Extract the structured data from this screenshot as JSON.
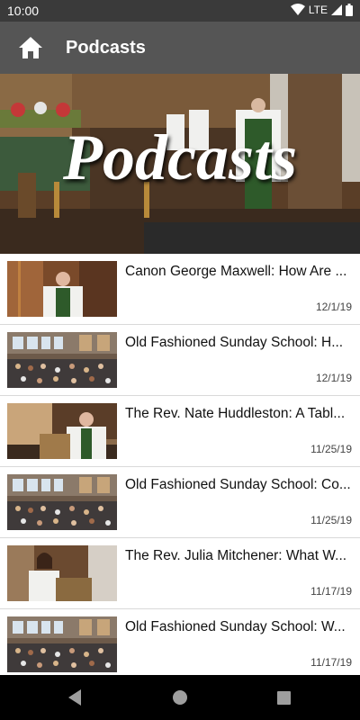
{
  "status_bar": {
    "time": "10:00",
    "network": "LTE"
  },
  "app_bar": {
    "title": "Podcasts"
  },
  "hero": {
    "title": "Podcasts"
  },
  "podcasts": [
    {
      "title": "Canon George Maxwell: How Are ...",
      "date": "12/1/19",
      "thumb": "priest"
    },
    {
      "title": "Old Fashioned Sunday School: H...",
      "date": "12/1/19",
      "thumb": "hall"
    },
    {
      "title": "The Rev. Nate Huddleston: A Tabl...",
      "date": "11/25/19",
      "thumb": "pulpit"
    },
    {
      "title": "Old Fashioned Sunday School: Co...",
      "date": "11/25/19",
      "thumb": "hall"
    },
    {
      "title": "The Rev. Julia Mitchener: What W...",
      "date": "11/17/19",
      "thumb": "lectern"
    },
    {
      "title": "Old Fashioned Sunday School: W...",
      "date": "11/17/19",
      "thumb": "hall"
    }
  ]
}
